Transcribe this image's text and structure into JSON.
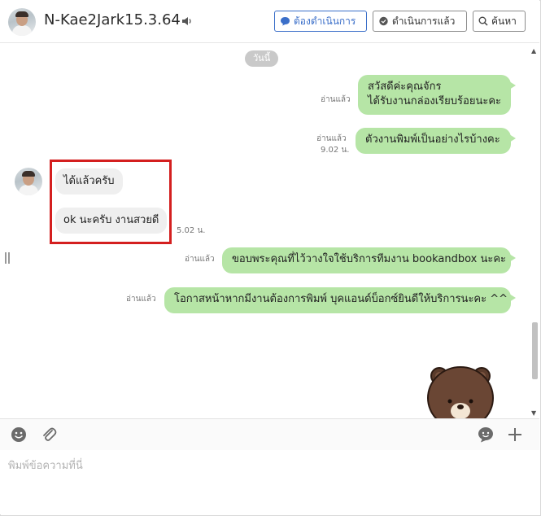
{
  "header": {
    "contact_name": "N-Kae2Jark15.3.64",
    "buttons": {
      "todo": "ต้องดำเนินการ",
      "done": "ดำเนินการแล้ว",
      "search": "ค้นหา"
    }
  },
  "chat": {
    "date_label": "วันนี้",
    "messages": [
      {
        "direction": "out",
        "lines": [
          "สวัสดีค่ะคุณจักร",
          "ได้รับงานกล่องเรียบร้อยนะคะ"
        ],
        "read": "อ่านแล้ว",
        "time": ""
      },
      {
        "direction": "out",
        "lines": [
          "ตัวงานพิมพ์เป็นอย่างไรบ้างคะ"
        ],
        "read": "อ่านแล้ว",
        "time": "9.02 น."
      },
      {
        "direction": "in",
        "lines": [
          "ได้แล้วครับ"
        ],
        "time": ""
      },
      {
        "direction": "in",
        "lines": [
          "ok นะครับ งานสวยดี"
        ],
        "time": "5.02 น."
      },
      {
        "direction": "out",
        "lines": [
          "ขอบพระคุณที่ไว้วางใจใช้บริการทีมงาน bookandbox นะคะ"
        ],
        "read": "อ่านแล้ว",
        "time": ""
      },
      {
        "direction": "out",
        "lines": [
          "โอกาสหน้าหากมีงานต้องการพิมพ์ บุคแอนด์บ็อกซ์ยินดีให้บริการนะคะ ^^"
        ],
        "read": "อ่านแล้ว",
        "time": ""
      }
    ]
  },
  "input": {
    "placeholder": "พิมพ์ข้อความที่นี่"
  },
  "colors": {
    "outgoing_bubble": "#b6e5a6",
    "incoming_bubble": "#efefef",
    "highlight_box": "#d41f1f",
    "accent": "#3b6fc9"
  },
  "icons": [
    "speaker-icon",
    "chat-bubble-icon",
    "search-icon",
    "emoji-icon",
    "attachment-icon",
    "sticker-icon",
    "plus-icon"
  ]
}
